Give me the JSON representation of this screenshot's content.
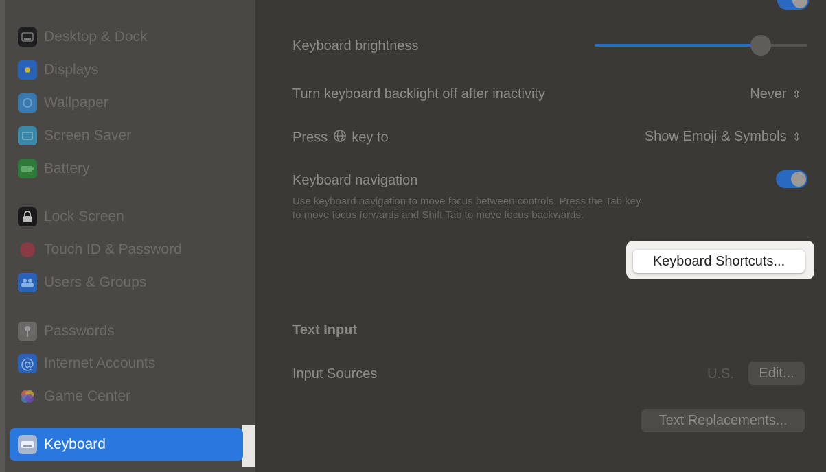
{
  "sidebar": {
    "items": [
      {
        "label": "Desktop & Dock",
        "icon": "desktop-dock-icon",
        "color": "#1f1f1f"
      },
      {
        "label": "Displays",
        "icon": "displays-icon",
        "color": "#2a62b8"
      },
      {
        "label": "Wallpaper",
        "icon": "wallpaper-icon",
        "color": "#3a78b0"
      },
      {
        "label": "Screen Saver",
        "icon": "screen-saver-icon",
        "color": "#3b88a8"
      },
      {
        "label": "Battery",
        "icon": "battery-icon",
        "color": "#2e7a38"
      },
      {
        "label": "Lock Screen",
        "icon": "lock-icon",
        "color": "#1b1b1b"
      },
      {
        "label": "Touch ID & Password",
        "icon": "fingerprint-icon",
        "color": "#8a3a42"
      },
      {
        "label": "Users & Groups",
        "icon": "users-icon",
        "color": "#2a62b8"
      },
      {
        "label": "Passwords",
        "icon": "key-icon",
        "color": "#6a6865"
      },
      {
        "label": "Internet Accounts",
        "icon": "at-sign-icon",
        "color": "#2a62b8"
      },
      {
        "label": "Game Center",
        "icon": "game-center-icon",
        "color": "#7a4a9a"
      }
    ],
    "active": {
      "label": "Keyboard",
      "icon": "keyboard-icon"
    }
  },
  "content": {
    "brightness_label": "Keyboard brightness",
    "brightness_level": 0.78,
    "backlight_label": "Turn keyboard backlight off after inactivity",
    "backlight_value": "Never",
    "press_key_prefix": "Press",
    "press_key_suffix": "key to",
    "press_key_value": "Show Emoji & Symbols",
    "nav_label": "Keyboard navigation",
    "nav_desc_line1": "Use keyboard navigation to move focus between controls. Press the Tab key",
    "nav_desc_line2": "to move focus forwards and Shift Tab to move focus backwards.",
    "shortcuts_button": "Keyboard Shortcuts...",
    "text_input_title": "Text Input",
    "input_sources_label": "Input Sources",
    "input_sources_value": "U.S.",
    "edit_button": "Edit...",
    "replacements_button": "Text Replacements..."
  },
  "colors": {
    "accent": "#2978e0",
    "highlight": "#f2f0ec"
  }
}
